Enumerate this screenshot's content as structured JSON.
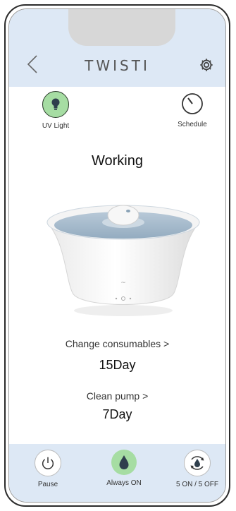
{
  "app": {
    "title": "TWISTI"
  },
  "features": {
    "uv_light": {
      "label": "UV Light",
      "icon": "lightbulb-icon"
    },
    "schedule": {
      "label": "Schedule",
      "icon": "timer-icon"
    }
  },
  "status": "Working",
  "device_image": {
    "icon": "water-fountain-device"
  },
  "consumables": {
    "change_label": "Change consumables >",
    "change_value": "15Day",
    "pump_label": "Clean pump >",
    "pump_value": "7Day"
  },
  "modes": [
    {
      "label": "Pause",
      "icon": "power-icon",
      "active": false
    },
    {
      "label": "Always ON",
      "icon": "water-drop-icon",
      "active": true
    },
    {
      "label": "5 ON / 5 OFF",
      "icon": "cycle-drop-icon",
      "active": false
    }
  ],
  "colors": {
    "header_bg": "#dde8f5",
    "active_green": "#a6dda3"
  }
}
